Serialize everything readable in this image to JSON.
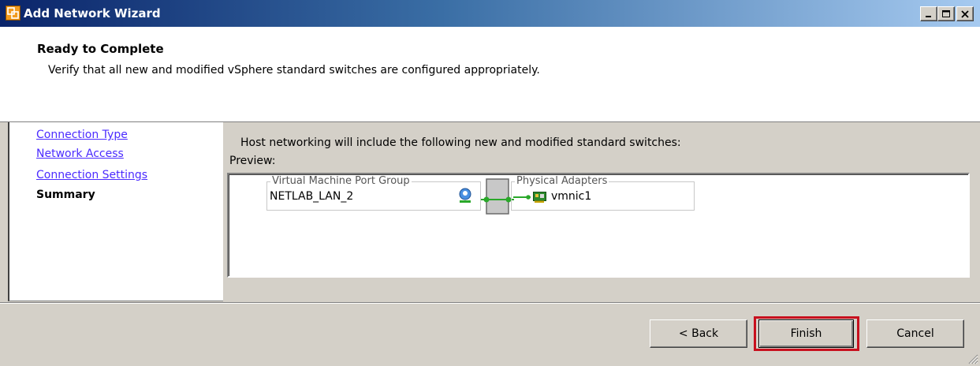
{
  "window": {
    "title": "Add Network Wizard",
    "controls": [
      "minimize-icon",
      "maximize-icon",
      "close-icon"
    ]
  },
  "header": {
    "title": "Ready to Complete",
    "subtitle": "Verify that all new and modified vSphere standard switches are configured appropriately."
  },
  "nav": {
    "items": [
      {
        "label": "Connection Type",
        "state": "link"
      },
      {
        "label": "Network Access",
        "state": "link"
      },
      {
        "label": "Connection Settings",
        "state": "link"
      },
      {
        "label": "Summary",
        "state": "current"
      }
    ]
  },
  "content": {
    "intro": "Host networking will include the following new and modified standard switches:",
    "preview_label": "Preview:",
    "port_group": {
      "legend": "Virtual Machine Port Group",
      "name": "NETLAB_LAN_2",
      "icon": "vm-network-icon"
    },
    "physical_adapters": {
      "legend": "Physical Adapters",
      "adapter": "vmnic1",
      "icon": "nic-icon"
    }
  },
  "footer": {
    "back_label": "< Back",
    "finish_label": "Finish",
    "cancel_label": "Cancel"
  },
  "colors": {
    "link": "#4b2bff",
    "finish_highlight": "#c8101e",
    "connector": "#2aa82a"
  }
}
